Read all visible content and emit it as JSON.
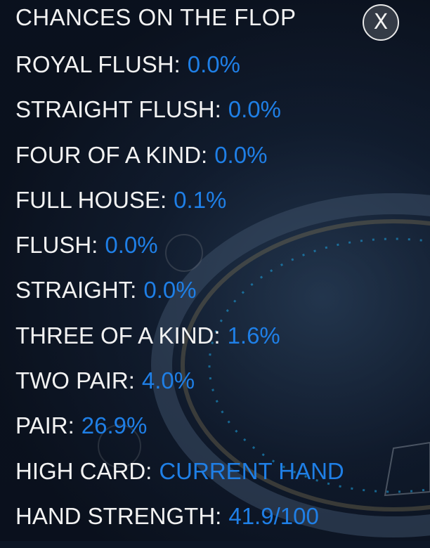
{
  "panel": {
    "title": "CHANCES ON THE FLOP",
    "close_label": "X"
  },
  "rows": [
    {
      "label": "ROYAL FLUSH:",
      "value": "0.0%"
    },
    {
      "label": "STRAIGHT FLUSH:",
      "value": "0.0%"
    },
    {
      "label": "FOUR OF A KIND:",
      "value": "0.0%"
    },
    {
      "label": "FULL HOUSE:",
      "value": "0.1%"
    },
    {
      "label": "FLUSH:",
      "value": "0.0%"
    },
    {
      "label": "STRAIGHT:",
      "value": "0.0%"
    },
    {
      "label": "THREE OF A KIND:",
      "value": "1.6%"
    },
    {
      "label": "TWO PAIR:",
      "value": "4.0%"
    },
    {
      "label": "PAIR:",
      "value": "26.9%"
    },
    {
      "label": "HIGH CARD:",
      "value": "CURRENT HAND"
    },
    {
      "label": "HAND STRENGTH:",
      "value": "41.9/100"
    }
  ],
  "colors": {
    "label": "#f2f2f2",
    "value": "#1f7fe6",
    "background": "#0d1626"
  }
}
